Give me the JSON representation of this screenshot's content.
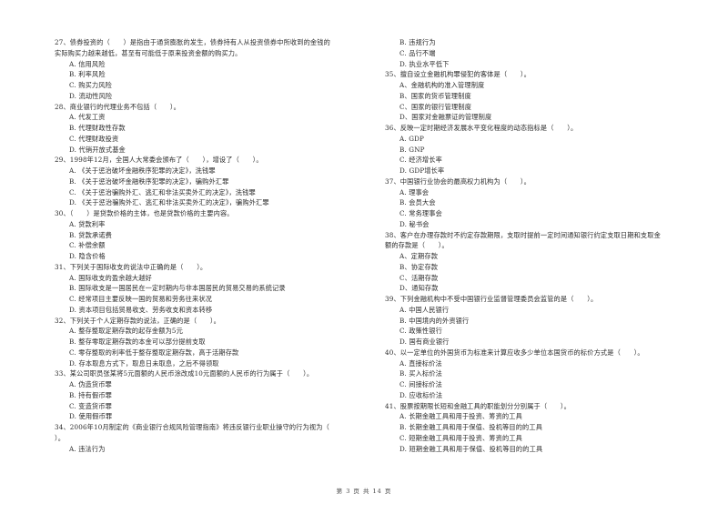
{
  "page": {
    "footer": "第 3 页 共 14 页"
  },
  "left_column": [
    {
      "type": "stem",
      "text": "27、债券投资的（　　）是指由于通货膨胀的发生，债券持有人从投资债券中所收到的金钱的"
    },
    {
      "type": "cont",
      "text": "实际购买力越来越低，甚至有可能低于原来投资金额的购买力。"
    },
    {
      "type": "opt",
      "text": "A. 信用风险"
    },
    {
      "type": "opt",
      "text": "B. 利率风险"
    },
    {
      "type": "opt",
      "text": "C. 购买力风险"
    },
    {
      "type": "opt",
      "text": "D. 流动性风险"
    },
    {
      "type": "stem",
      "text": "28、商业银行的代理业务不包括（　　）。"
    },
    {
      "type": "opt",
      "text": "A. 代发工资"
    },
    {
      "type": "opt",
      "text": "B. 代理财政性存款"
    },
    {
      "type": "opt",
      "text": "C. 代理财政投资"
    },
    {
      "type": "opt",
      "text": "D. 代销开放式基金"
    },
    {
      "type": "stem",
      "text": "29、1998年12月，全国人大常委会颁布了（　　），增设了（　　）。"
    },
    {
      "type": "opt",
      "text": "A. 《关于惩治破坏金融秩序犯罪的决定》，洗钱罪"
    },
    {
      "type": "opt",
      "text": "B. 《关于惩治破坏金融秩序犯罪的决定》，骗购外汇罪"
    },
    {
      "type": "opt",
      "text": "C. 《关于惩治骗购外汇、逃汇和非法买卖外汇的决定》，洗钱罪"
    },
    {
      "type": "opt",
      "text": "D. 《关于惩治骗购外汇、逃汇和非法买卖外汇的决定》，骗购外汇罪"
    },
    {
      "type": "stem",
      "text": "30、（　　）是贷款价格的主体，也是贷款价格的主要内容。"
    },
    {
      "type": "opt",
      "text": "A. 贷款利率"
    },
    {
      "type": "opt",
      "text": "B. 贷款承诺费"
    },
    {
      "type": "opt",
      "text": "C. 补偿余额"
    },
    {
      "type": "opt",
      "text": "D. 隐含价格"
    },
    {
      "type": "stem",
      "text": "31、下列关于国际收支的说法中正确的是（　　）。"
    },
    {
      "type": "opt",
      "text": "A. 国际收支的盈余越大越好"
    },
    {
      "type": "opt",
      "text": "B. 国际收支是一国居民在一定时期内与非本国居民的贸易交易的系统记录"
    },
    {
      "type": "opt",
      "text": "C. 经常项目主要反映一国的贸易和劳务往来状况"
    },
    {
      "type": "opt",
      "text": "D. 资本项目包括贸易收支、劳务收支和资本转移"
    },
    {
      "type": "stem",
      "text": "32、下列关于个人定期存款的说法，正确的是（　　）。"
    },
    {
      "type": "opt",
      "text": "A. 整存整取定期存款的起存金额为5元"
    },
    {
      "type": "opt",
      "text": "B. 整存零取定期存款的本金可以部分提前支取"
    },
    {
      "type": "opt",
      "text": "C. 零存整取的利率低于整存整取定期存款，高于活期存款"
    },
    {
      "type": "opt",
      "text": "D. 存本取息方式下，取息日未取息，之后不得领取"
    },
    {
      "type": "stem",
      "text": "33、某公司职员张某将5元面额的人民币涂改成10元面额的人民币的行为属于（　　）。"
    },
    {
      "type": "opt",
      "text": "A. 伪造货币罪"
    },
    {
      "type": "opt",
      "text": "B. 持有假币罪"
    },
    {
      "type": "opt",
      "text": "C. 变造货币罪"
    },
    {
      "type": "opt",
      "text": "D. 使用假币罪"
    },
    {
      "type": "stem",
      "text": "34、2006年10月制定的《商业银行合规风险管理指南》将违反银行业职业操守的行为视为（"
    },
    {
      "type": "cont",
      "text": "）。"
    },
    {
      "type": "opt",
      "text": "A. 违法行为"
    }
  ],
  "right_column": [
    {
      "type": "opt",
      "text": "B. 违规行为"
    },
    {
      "type": "opt",
      "text": "C. 品行不端"
    },
    {
      "type": "opt",
      "text": "D. 执业水平低下"
    },
    {
      "type": "stem",
      "text": "35、擅自设立金融机构罪侵犯的客体是（　　）。"
    },
    {
      "type": "opt",
      "text": "A、金融机构的准入管理制度"
    },
    {
      "type": "opt",
      "text": "B、国家的货币管理制度"
    },
    {
      "type": "opt",
      "text": "C、国家的银行管理制度"
    },
    {
      "type": "opt",
      "text": "D、国家对金融票证的管理制度"
    },
    {
      "type": "stem",
      "text": "36、反映一定时期经济发展水平变化程度的动态指标是（　　）。"
    },
    {
      "type": "opt",
      "text": "A. GDP"
    },
    {
      "type": "opt",
      "text": "B. GNP"
    },
    {
      "type": "opt",
      "text": "C. 经济增长率"
    },
    {
      "type": "opt",
      "text": "D. GDP增长率"
    },
    {
      "type": "stem",
      "text": "37、中国银行业协会的最高权力机构为（　　）。"
    },
    {
      "type": "opt",
      "text": "A. 理事会"
    },
    {
      "type": "opt",
      "text": "B. 会员大会"
    },
    {
      "type": "opt",
      "text": "C. 常务理事会"
    },
    {
      "type": "opt",
      "text": "D. 秘书会"
    },
    {
      "type": "stem",
      "text": "38、客户在办理存款时不约定存款期限，支取时提前一定时间通知银行约定支取日期和支取金"
    },
    {
      "type": "cont",
      "text": "额的存款是（　　）。"
    },
    {
      "type": "opt",
      "text": "A、定期存款"
    },
    {
      "type": "opt",
      "text": "B、协定存款"
    },
    {
      "type": "opt",
      "text": "C、活期存款"
    },
    {
      "type": "opt",
      "text": "D、通知存款"
    },
    {
      "type": "stem",
      "text": "39、下列金融机构中不受中国银行业监督管理委员会监管的是（　　）。"
    },
    {
      "type": "opt",
      "text": "A. 中国人民银行"
    },
    {
      "type": "opt",
      "text": "B. 中国境内的外资银行"
    },
    {
      "type": "opt",
      "text": "C. 政策性银行"
    },
    {
      "type": "opt",
      "text": "D. 国有商业银行"
    },
    {
      "type": "stem",
      "text": "40、以一定单位的外国货币为标准来计算应收多少单位本国货币的标价方式是（　　）。"
    },
    {
      "type": "opt",
      "text": "A. 直接标价法"
    },
    {
      "type": "opt",
      "text": "B. 买入标价法"
    },
    {
      "type": "opt",
      "text": "C. 间接标价法"
    },
    {
      "type": "opt",
      "text": "D. 应收标价法"
    },
    {
      "type": "stem",
      "text": "41、股票按期限长短和金融工具的职能划分分别属于（　　）。"
    },
    {
      "type": "opt",
      "text": "A. 长期金融工具和用于投资、筹资的工具"
    },
    {
      "type": "opt",
      "text": "B. 长期金融工具和用于保值、投机等目的的工具"
    },
    {
      "type": "opt",
      "text": "C. 短期金融工具和用于投资、筹资的工具"
    },
    {
      "type": "opt",
      "text": "D. 短期金融工具和用于保值、投机等目的的工具"
    }
  ]
}
